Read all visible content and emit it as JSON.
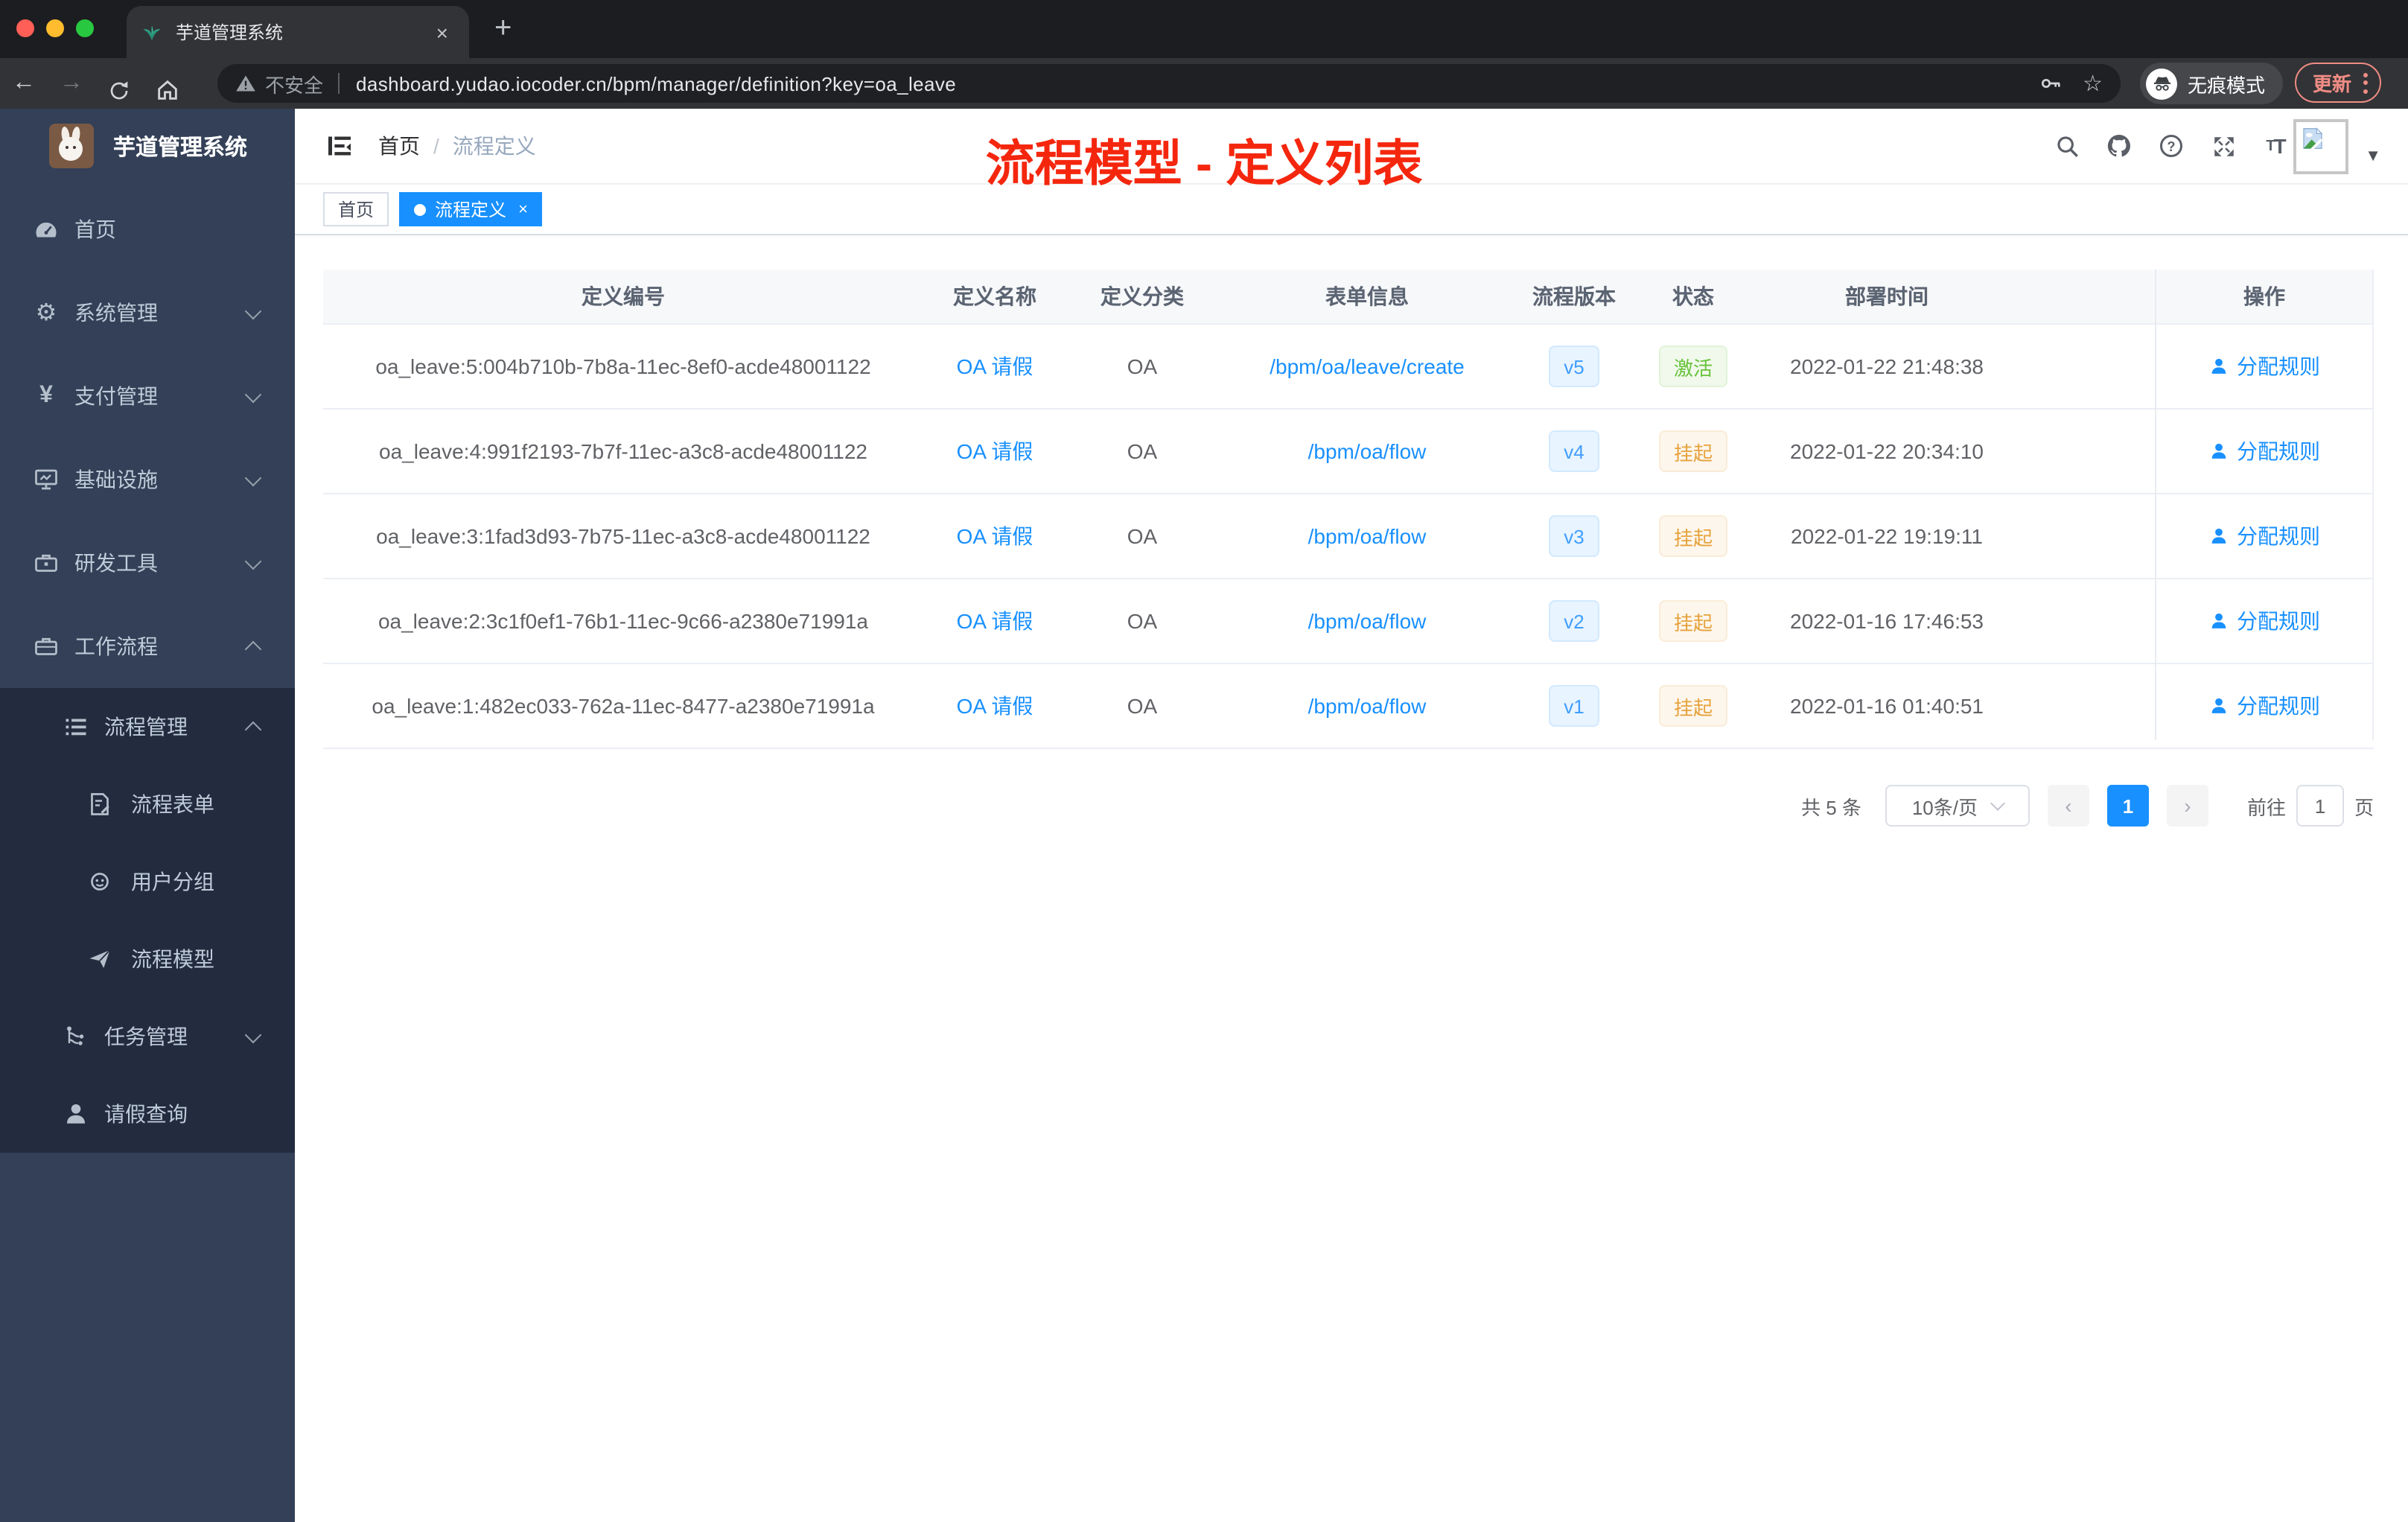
{
  "colors": {
    "primary": "#1890ff",
    "success": "#67c23a",
    "warning": "#e6a23c",
    "annotation_red": "#f4270e",
    "sidebar_bg": "#334057",
    "submenu_bg": "#222c3e",
    "active_tab_blue": "#1890ff"
  },
  "browser": {
    "tab": {
      "title": "芋道管理系统",
      "close": "×",
      "new_tab": "+",
      "favicon": "leaf-icon"
    },
    "toolbar": {
      "security_label": "不安全",
      "url": "dashboard.yudao.iocoder.cn/bpm/manager/definition?key=oa_leave",
      "incognito_label": "无痕模式",
      "update_label": "更新"
    }
  },
  "sidebar": {
    "title": "芋道管理系统",
    "items": [
      {
        "label": "首页",
        "icon": "gauge-icon"
      },
      {
        "label": "系统管理",
        "icon": "gear-icon",
        "expanded": false
      },
      {
        "label": "支付管理",
        "icon": "yen-icon",
        "expanded": false
      },
      {
        "label": "基础设施",
        "icon": "monitor-icon",
        "expanded": false
      },
      {
        "label": "研发工具",
        "icon": "toolbox-icon",
        "expanded": false
      },
      {
        "label": "工作流程",
        "icon": "briefcase-icon",
        "expanded": true,
        "children": [
          {
            "label": "流程管理",
            "icon": "list-icon",
            "expanded": true,
            "children": [
              {
                "label": "流程表单",
                "icon": "form-icon"
              },
              {
                "label": "用户分组",
                "icon": "group-icon"
              },
              {
                "label": "流程模型",
                "icon": "send-icon"
              }
            ]
          },
          {
            "label": "任务管理",
            "icon": "tree-icon",
            "expanded": false
          },
          {
            "label": "请假查询",
            "icon": "user-icon"
          }
        ]
      }
    ]
  },
  "header": {
    "breadcrumb": [
      "首页",
      "流程定义"
    ],
    "separator": "/",
    "annotation": "流程模型 - 定义列表",
    "icons": [
      "search-icon",
      "github-icon",
      "question-icon",
      "fullscreen-icon",
      "font-size-icon"
    ]
  },
  "tags": [
    {
      "label": "首页",
      "active": false
    },
    {
      "label": "流程定义",
      "active": true,
      "close": "×"
    }
  ],
  "table": {
    "columns": [
      "定义编号",
      "定义名称",
      "定义分类",
      "表单信息",
      "流程版本",
      "状态",
      "部署时间",
      "操作"
    ],
    "rows": [
      {
        "id": "oa_leave:5:004b710b-7b8a-11ec-8ef0-acde48001122",
        "name": "OA 请假",
        "category": "OA",
        "form": "/bpm/oa/leave/create",
        "version": "v5",
        "status": "激活",
        "status_type": "success",
        "deployed_at": "2022-01-22 21:48:38",
        "action": "分配规则"
      },
      {
        "id": "oa_leave:4:991f2193-7b7f-11ec-a3c8-acde48001122",
        "name": "OA 请假",
        "category": "OA",
        "form": "/bpm/oa/flow",
        "version": "v4",
        "status": "挂起",
        "status_type": "warning",
        "deployed_at": "2022-01-22 20:34:10",
        "action": "分配规则"
      },
      {
        "id": "oa_leave:3:1fad3d93-7b75-11ec-a3c8-acde48001122",
        "name": "OA 请假",
        "category": "OA",
        "form": "/bpm/oa/flow",
        "version": "v3",
        "status": "挂起",
        "status_type": "warning",
        "deployed_at": "2022-01-22 19:19:11",
        "action": "分配规则"
      },
      {
        "id": "oa_leave:2:3c1f0ef1-76b1-11ec-9c66-a2380e71991a",
        "name": "OA 请假",
        "category": "OA",
        "form": "/bpm/oa/flow",
        "version": "v2",
        "status": "挂起",
        "status_type": "warning",
        "deployed_at": "2022-01-16 17:46:53",
        "action": "分配规则"
      },
      {
        "id": "oa_leave:1:482ec033-762a-11ec-8477-a2380e71991a",
        "name": "OA 请假",
        "category": "OA",
        "form": "/bpm/oa/flow",
        "version": "v1",
        "status": "挂起",
        "status_type": "warning",
        "deployed_at": "2022-01-16 01:40:51",
        "action": "分配规则"
      }
    ]
  },
  "pagination": {
    "total": "共 5 条",
    "page_size": "10条/页",
    "prev": "‹",
    "page": "1",
    "next": "›",
    "goto_label": "前往",
    "goto_value": "1",
    "unit_label": "页"
  }
}
